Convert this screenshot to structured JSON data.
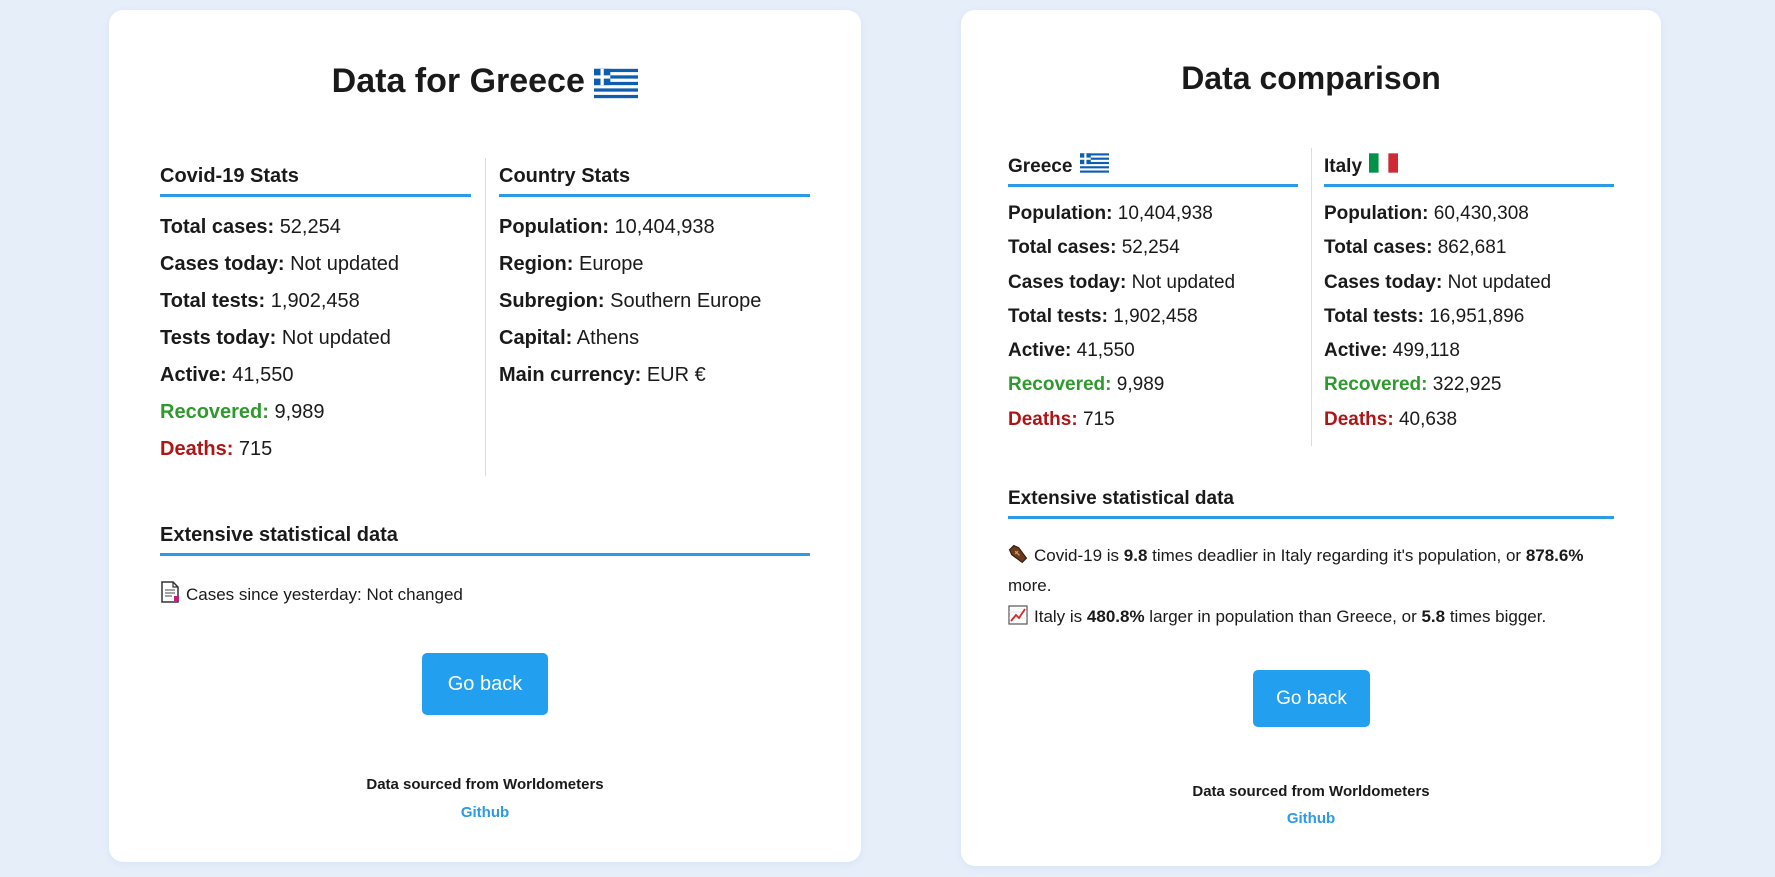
{
  "left": {
    "title": "Data for Greece",
    "covid_header": "Covid-19 Stats",
    "country_header": "Country Stats",
    "covid_stats": [
      {
        "label": "Total cases:",
        "value": "52,254"
      },
      {
        "label": "Cases today:",
        "value": "Not updated"
      },
      {
        "label": "Total tests:",
        "value": "1,902,458"
      },
      {
        "label": "Tests today:",
        "value": "Not updated"
      },
      {
        "label": "Active:",
        "value": "41,550"
      },
      {
        "label": "Recovered:",
        "value": "9,989"
      },
      {
        "label": "Deaths:",
        "value": "715"
      }
    ],
    "country_stats": [
      {
        "label": "Population:",
        "value": "10,404,938"
      },
      {
        "label": "Region:",
        "value": "Europe"
      },
      {
        "label": "Subregion:",
        "value": "Southern Europe"
      },
      {
        "label": "Capital:",
        "value": "Athens"
      },
      {
        "label": "Main currency:",
        "value": "EUR €"
      }
    ],
    "extensive_header": "Extensive statistical data",
    "cases_since": "Cases since yesterday: Not changed",
    "go_back": "Go back",
    "source": "Data sourced from Worldometers",
    "github": "Github"
  },
  "right": {
    "title": "Data comparison",
    "country_a": "Greece",
    "country_b": "Italy",
    "stats_a": [
      {
        "label": "Population:",
        "value": "10,404,938"
      },
      {
        "label": "Total cases:",
        "value": "52,254"
      },
      {
        "label": "Cases today:",
        "value": "Not updated"
      },
      {
        "label": "Total tests:",
        "value": "1,902,458"
      },
      {
        "label": "Active:",
        "value": "41,550"
      },
      {
        "label": "Recovered:",
        "value": "9,989"
      },
      {
        "label": "Deaths:",
        "value": "715"
      }
    ],
    "stats_b": [
      {
        "label": "Population:",
        "value": "60,430,308"
      },
      {
        "label": "Total cases:",
        "value": "862,681"
      },
      {
        "label": "Cases today:",
        "value": "Not updated"
      },
      {
        "label": "Total tests:",
        "value": "16,951,896"
      },
      {
        "label": "Active:",
        "value": "499,118"
      },
      {
        "label": "Recovered:",
        "value": "322,925"
      },
      {
        "label": "Deaths:",
        "value": "40,638"
      }
    ],
    "extensive_header": "Extensive statistical data",
    "line1": {
      "a": "Covid-19 is ",
      "b1": "9.8",
      "c": " times deadlier in Italy regarding it's population, or ",
      "b2": "878.6%",
      "d": " more."
    },
    "line2": {
      "a": "Italy is ",
      "b1": "480.8%",
      "c": " larger in population than Greece, or ",
      "b2": "5.8",
      "d": " times bigger."
    },
    "go_back": "Go back",
    "source": "Data sourced from Worldometers",
    "github": "Github"
  },
  "icons": {
    "greece_flag": "greece-flag-icon",
    "italy_flag": "italy-flag-icon",
    "page": "page-icon",
    "coffin": "coffin-icon",
    "chart": "chart-increasing-icon"
  },
  "colors": {
    "accent": "#2b9be5",
    "button": "#22a0ef",
    "recovered": "#2e9a2e",
    "deaths": "#b01515",
    "background": "#e6eefa"
  }
}
